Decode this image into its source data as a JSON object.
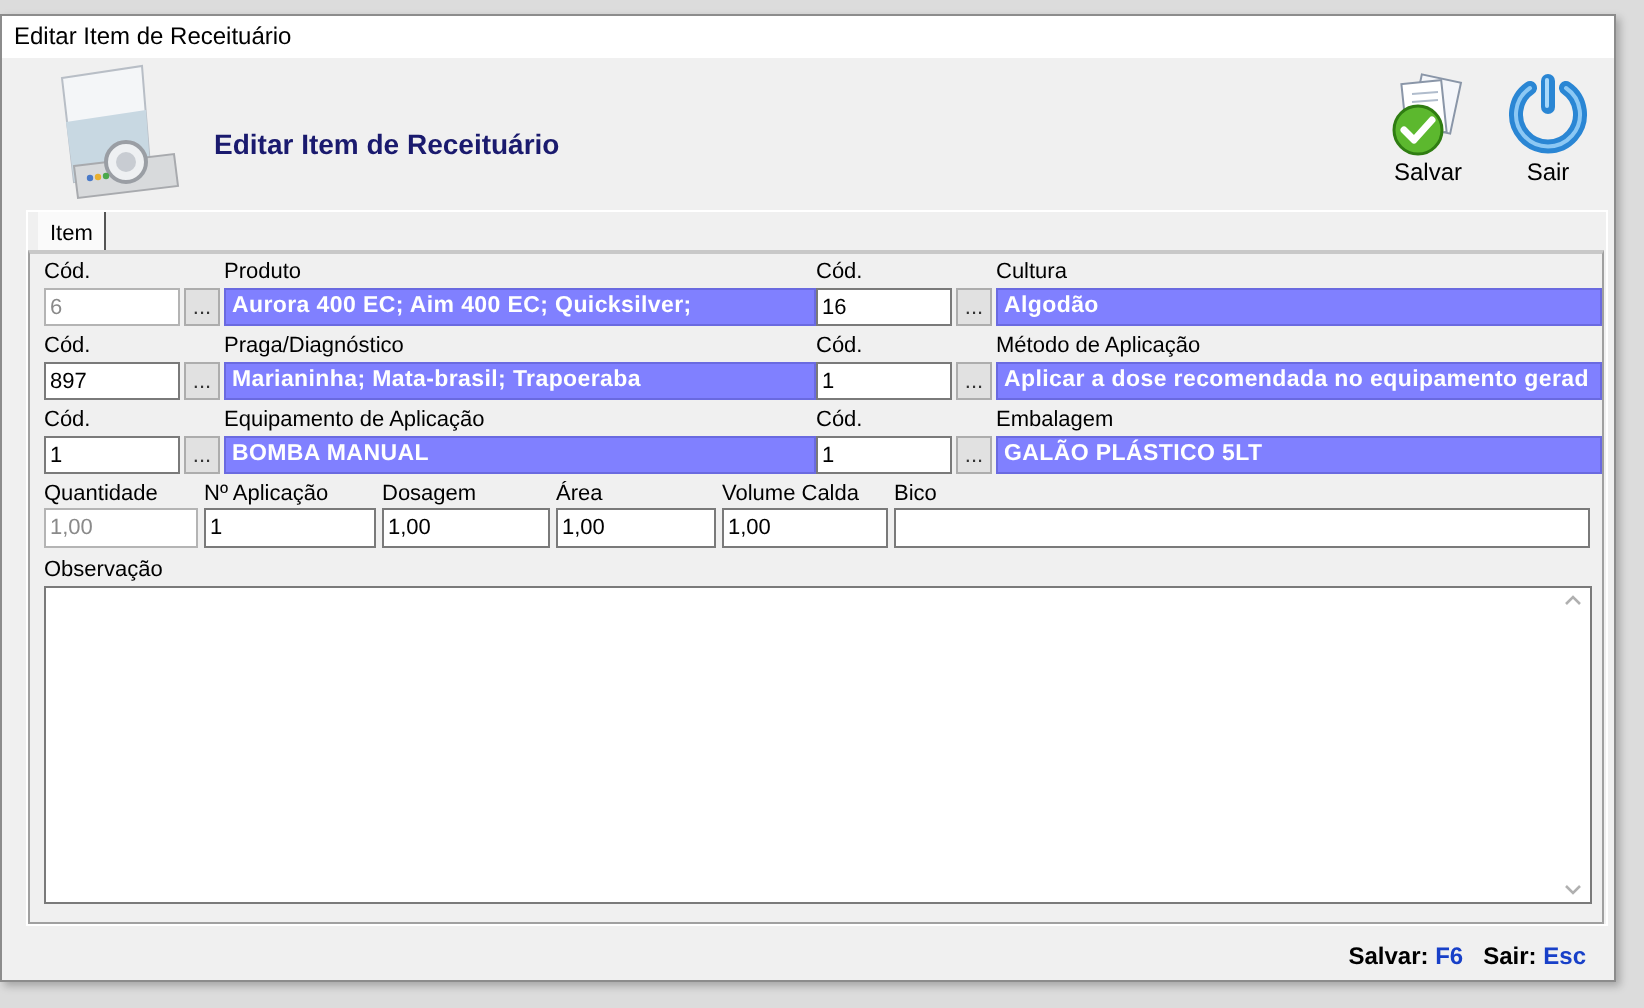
{
  "window": {
    "title": "Editar Item de Receituário"
  },
  "header": {
    "title": "Editar Item de Receituário"
  },
  "toolbar": [
    {
      "label": "Salvar",
      "kind": "save"
    },
    {
      "label": "Sair",
      "kind": "exit"
    }
  ],
  "tabs": [
    {
      "label": "Item",
      "selected": true
    }
  ],
  "lookup_rows": [
    [
      {
        "code_label": "Cód.",
        "code": "6",
        "code_disabled": true,
        "button": "...",
        "name_label": "Produto",
        "name": "Aurora 400 EC; Aim 400 EC; Quicksilver;"
      },
      {
        "code_label": "Cód.",
        "code": "16",
        "code_disabled": false,
        "button": "...",
        "name_label": "Cultura",
        "name": "Algodão"
      }
    ],
    [
      {
        "code_label": "Cód.",
        "code": "897",
        "code_disabled": false,
        "button": "...",
        "name_label": "Praga/Diagnóstico",
        "name": "Marianinha; Mata-brasil; Trapoeraba"
      },
      {
        "code_label": "Cód.",
        "code": "1",
        "code_disabled": false,
        "button": "...",
        "name_label": "Método de Aplicação",
        "name": " Aplicar a dose recomendada no equipamento gerad"
      }
    ],
    [
      {
        "code_label": "Cód.",
        "code": "1",
        "code_disabled": false,
        "button": "...",
        "name_label": "Equipamento de Aplicação",
        "name": "BOMBA MANUAL"
      },
      {
        "code_label": "Cód.",
        "code": "1",
        "code_disabled": false,
        "button": "...",
        "name_label": "Embalagem",
        "name": "GALÃO PLÁSTICO 5LT"
      }
    ]
  ],
  "fields": [
    {
      "label": "Quantidade",
      "value": "1,00",
      "disabled": true
    },
    {
      "label": "Nº Aplicação",
      "value": "1",
      "disabled": false
    },
    {
      "label": "Dosagem",
      "value": "1,00",
      "disabled": false
    },
    {
      "label": "Área",
      "value": "1,00",
      "disabled": false
    },
    {
      "label": "Volume Calda",
      "value": "1,00",
      "disabled": false
    },
    {
      "label": "Bico",
      "disabled": false
    }
  ],
  "observation": {
    "label": "Observação"
  },
  "status_bar": [
    {
      "label": "Salvar:",
      "key": "F6"
    },
    {
      "label": "Sair:",
      "key": "Esc"
    }
  ]
}
